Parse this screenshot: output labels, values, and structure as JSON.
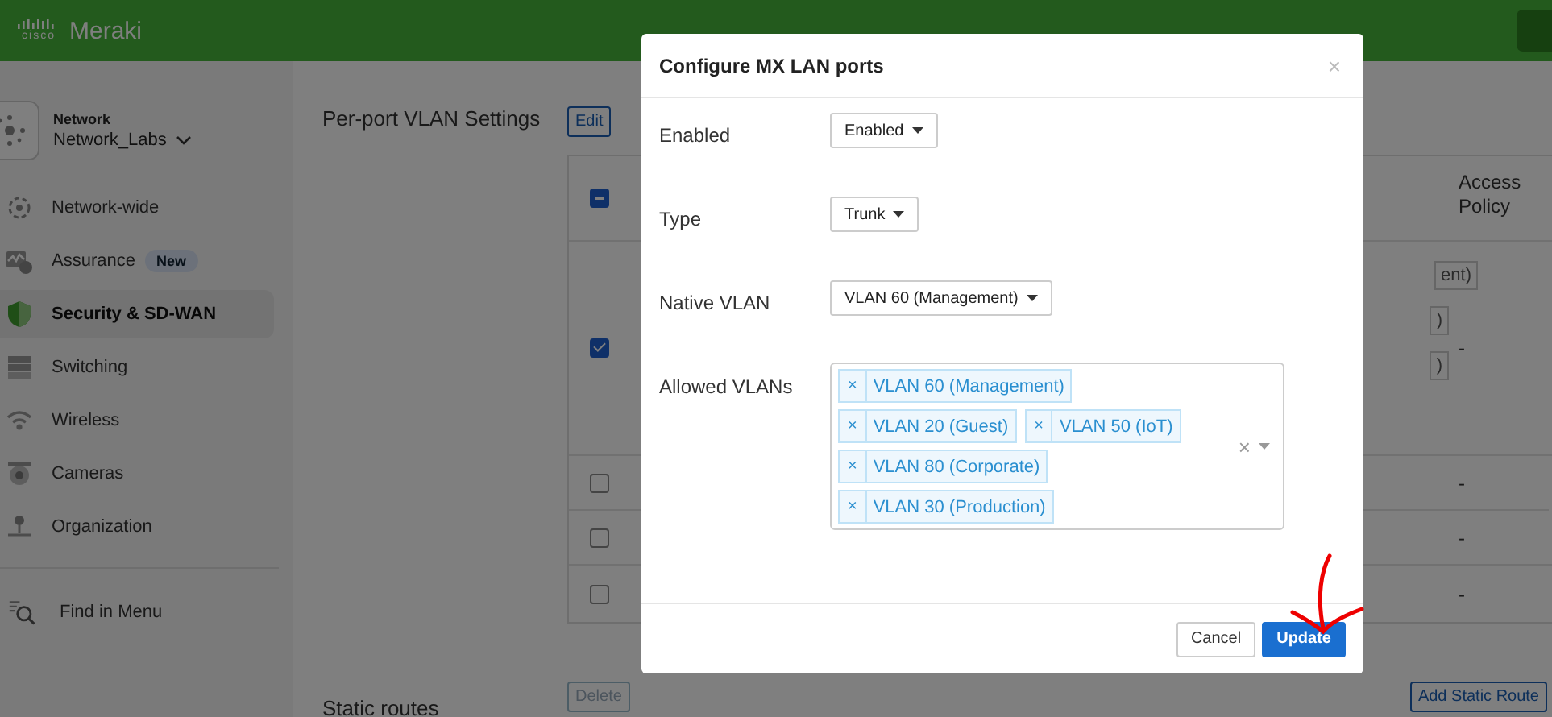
{
  "header": {
    "brand_small": "cisco",
    "brand": "Meraki"
  },
  "sidebar": {
    "network": {
      "label": "Network",
      "name": "Network_Labs"
    },
    "items": [
      {
        "label": "Network-wide",
        "kind": "network",
        "selected": false
      },
      {
        "label": "Assurance",
        "kind": "assurance",
        "badge": "New",
        "selected": false
      },
      {
        "label": "Security & SD-WAN",
        "kind": "security",
        "selected": true
      },
      {
        "label": "Switching",
        "kind": "switching",
        "selected": false
      },
      {
        "label": "Wireless",
        "kind": "wireless",
        "selected": false
      },
      {
        "label": "Cameras",
        "kind": "cameras",
        "selected": false
      },
      {
        "label": "Organization",
        "kind": "organization",
        "selected": false
      }
    ],
    "find": "Find in Menu"
  },
  "main": {
    "title": "Per-port VLAN Settings",
    "edit": "Edit",
    "table": {
      "select_all": {
        "indeterminate": true
      },
      "access_policy_header": "Access Policy",
      "rows": [
        {
          "checked": true,
          "tags": [
            "ent)",
            ")",
            ")"
          ],
          "access_policy": "-"
        },
        {
          "checked": false,
          "tags": [],
          "access_policy": "-"
        },
        {
          "checked": false,
          "tags": [],
          "access_policy": "-"
        },
        {
          "checked": false,
          "tags": [],
          "access_policy": "-"
        }
      ]
    },
    "static_routes": {
      "title": "Static routes",
      "delete": "Delete",
      "add": "Add Static Route"
    }
  },
  "modal": {
    "title": "Configure MX LAN ports",
    "close": "×",
    "fields": [
      {
        "label": "Enabled",
        "kind": "select",
        "value": "Enabled"
      },
      {
        "label": "Type",
        "kind": "select",
        "value": "Trunk"
      },
      {
        "label": "Native VLAN",
        "kind": "select",
        "value": "VLAN 60 (Management)"
      },
      {
        "label": "Allowed VLANs",
        "kind": "tags",
        "clear": "×",
        "remove": "×",
        "tags": [
          [
            "VLAN 60 (Management)"
          ],
          [
            "VLAN 20 (Guest)",
            "VLAN 50 (IoT)"
          ],
          [
            "VLAN 80 (Corporate)"
          ],
          [
            "VLAN 30 (Production)"
          ]
        ]
      }
    ],
    "buttons": [
      {
        "label": "Cancel",
        "kind": "secondary"
      },
      {
        "label": "Update",
        "kind": "primary"
      }
    ]
  }
}
